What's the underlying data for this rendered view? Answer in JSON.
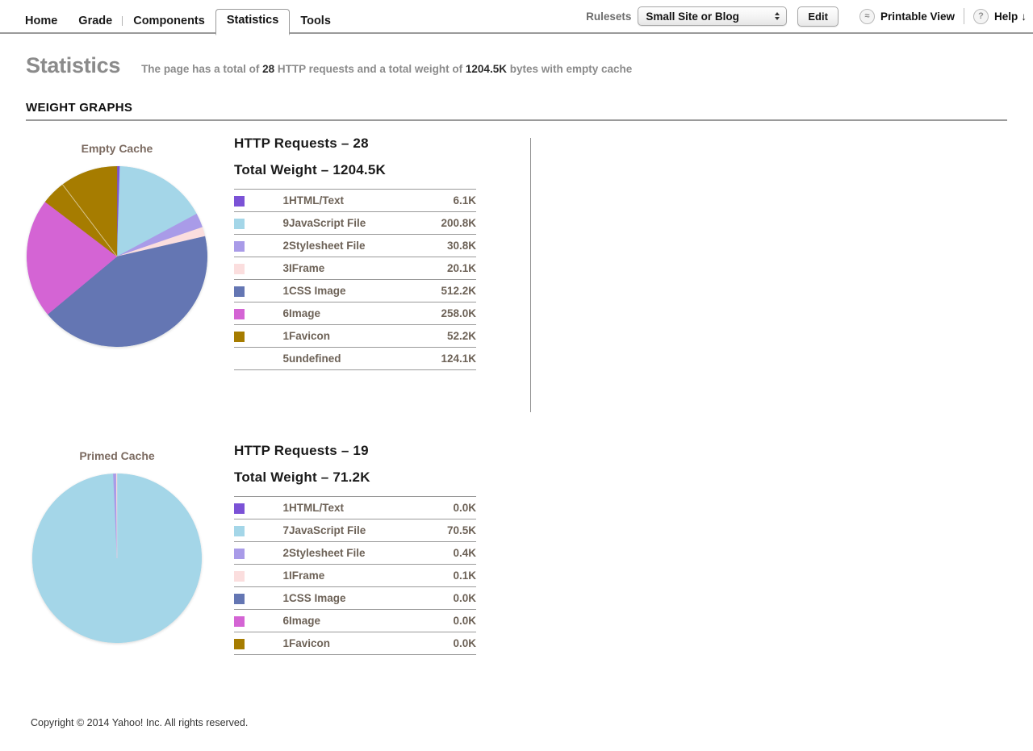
{
  "nav": {
    "tabs": [
      {
        "label": "Home",
        "active": false
      },
      {
        "label": "Grade",
        "active": false
      },
      {
        "label": "Components",
        "active": false
      },
      {
        "label": "Statistics",
        "active": true
      },
      {
        "label": "Tools",
        "active": false
      }
    ],
    "rulesets_label": "Rulesets",
    "ruleset_selected": "Small Site or Blog",
    "ruleset_options": [
      "Small Site or Blog"
    ],
    "edit_button": "Edit",
    "printable_view": "Printable View",
    "printable_icon_glyph": "≈",
    "help": "Help",
    "help_icon_glyph": "?",
    "help_arrow_glyph": "↓"
  },
  "header": {
    "title": "Statistics",
    "summary_prefix": "The page has a total of ",
    "summary_requests": "28",
    "summary_mid": " HTTP requests and a total weight of ",
    "summary_weight": "1204.5K",
    "summary_suffix": " bytes with empty cache",
    "section_title": "WEIGHT GRAPHS"
  },
  "colors": {
    "html_text": "#7B52D6",
    "javascript": "#A4D6E8",
    "stylesheet": "#A99BE8",
    "iframe": "#FBDEDE",
    "css_image": "#6476B3",
    "image": "#D464D4",
    "favicon": "#A67C00",
    "undefined": "#A67C00",
    "divider": "#9a9a9a",
    "accent_title": "#8b8b8b"
  },
  "chart_data": [
    {
      "type": "pie",
      "title": "Empty Cache",
      "requests_label": "HTTP Requests – 28",
      "weight_label": "Total Weight – 1204.5K",
      "requests_total": 28,
      "weight_total_k": 1204.5,
      "unit": "K",
      "legend_position": "right",
      "categories": [
        "HTML/Text",
        "JavaScript File",
        "Stylesheet File",
        "IFrame",
        "CSS Image",
        "Image",
        "Favicon",
        "undefined"
      ],
      "counts": [
        1,
        9,
        2,
        3,
        1,
        6,
        1,
        5
      ],
      "values": [
        6.1,
        200.8,
        30.8,
        20.1,
        512.2,
        258.0,
        52.2,
        124.1
      ],
      "value_labels": [
        "6.1K",
        "200.8K",
        "30.8K",
        "20.1K",
        "512.2K",
        "258.0K",
        "52.2K",
        "124.1K"
      ],
      "slice_colors": [
        "#7B52D6",
        "#A4D6E8",
        "#A99BE8",
        "#FBDEDE",
        "#6476B3",
        "#D464D4",
        "#A67C00",
        "#A67C00"
      ],
      "swatch_visible": [
        true,
        true,
        true,
        true,
        true,
        true,
        true,
        false
      ]
    },
    {
      "type": "pie",
      "title": "Primed Cache",
      "requests_label": "HTTP Requests – 19",
      "weight_label": "Total Weight – 71.2K",
      "requests_total": 19,
      "weight_total_k": 71.2,
      "unit": "K",
      "legend_position": "right",
      "categories": [
        "HTML/Text",
        "JavaScript File",
        "Stylesheet File",
        "IFrame",
        "CSS Image",
        "Image",
        "Favicon"
      ],
      "counts": [
        1,
        7,
        2,
        1,
        1,
        6,
        1
      ],
      "values": [
        0.0,
        70.5,
        0.4,
        0.1,
        0.0,
        0.0,
        0.0
      ],
      "value_labels": [
        "0.0K",
        "70.5K",
        "0.4K",
        "0.1K",
        "0.0K",
        "0.0K",
        "0.0K"
      ],
      "slice_colors": [
        "#7B52D6",
        "#A4D6E8",
        "#A99BE8",
        "#FBDEDE",
        "#6476B3",
        "#D464D4",
        "#A67C00"
      ],
      "swatch_visible": [
        true,
        true,
        true,
        true,
        true,
        true,
        true
      ]
    }
  ],
  "footer": {
    "copyright": "Copyright © 2014 Yahoo! Inc. All rights reserved."
  }
}
